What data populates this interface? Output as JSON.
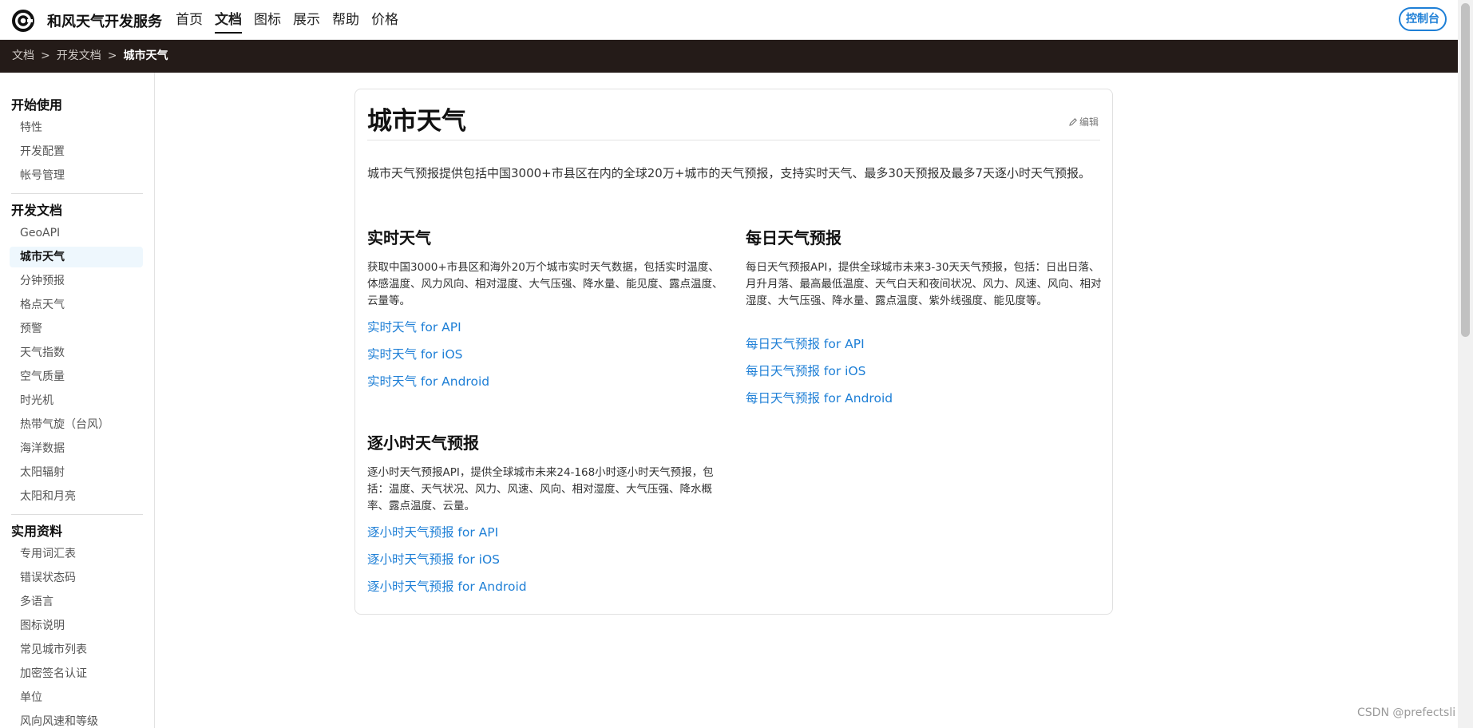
{
  "header": {
    "brand": "和风天气开发服务",
    "nav": [
      "首页",
      "文档",
      "图标",
      "展示",
      "帮助",
      "价格"
    ],
    "active_nav": "文档",
    "console_label": "控制台"
  },
  "breadcrumb": {
    "items": [
      "文档",
      "开发文档",
      "城市天气"
    ],
    "separator": ">"
  },
  "sidebar": {
    "sections": [
      {
        "title": "开始使用",
        "items": [
          "特性",
          "开发配置",
          "帐号管理"
        ]
      },
      {
        "title": "开发文档",
        "items": [
          "GeoAPI",
          "城市天气",
          "分钟预报",
          "格点天气",
          "预警",
          "天气指数",
          "空气质量",
          "时光机",
          "热带气旋（台风）",
          "海洋数据",
          "太阳辐射",
          "太阳和月亮"
        ]
      },
      {
        "title": "实用资料",
        "items": [
          "专用词汇表",
          "错误状态码",
          "多语言",
          "图标说明",
          "常见城市列表",
          "加密签名认证",
          "单位",
          "风向风速和等级"
        ]
      }
    ],
    "active_item": "城市天气"
  },
  "main": {
    "title": "城市天气",
    "edit_label": "编辑",
    "intro": "城市天气预报提供包括中国3000+市县区在内的全球20万+城市的天气预报，支持实时天气、最多30天预报及最多7天逐小时天气预报。",
    "cards": [
      {
        "title": "实时天气",
        "desc": "获取中国3000+市县区和海外20万个城市实时天气数据，包括实时温度、体感温度、风力风向、相对湿度、大气压强、降水量、能见度、露点温度、云量等。",
        "links": [
          "实时天气 for API",
          "实时天气 for iOS",
          "实时天气 for Android"
        ]
      },
      {
        "title": "每日天气预报",
        "desc": "每日天气预报API，提供全球城市未来3-30天天气预报，包括：日出日落、月升月落、最高最低温度、天气白天和夜间状况、风力、风速、风向、相对湿度、大气压强、降水量、露点温度、紫外线强度、能见度等。",
        "links": [
          "每日天气预报 for API",
          "每日天气预报 for iOS",
          "每日天气预报 for Android"
        ]
      },
      {
        "title": "逐小时天气预报",
        "desc": "逐小时天气预报API，提供全球城市未来24-168小时逐小时天气预报，包括：温度、天气状况、风力、风速、风向、相对湿度、大气压强、降水概率、露点温度、云量。",
        "links": [
          "逐小时天气预报 for API",
          "逐小时天气预报 for iOS",
          "逐小时天气预报 for Android"
        ]
      }
    ]
  },
  "watermark": "CSDN @prefectsli",
  "colors": {
    "link": "#1e7fd6",
    "breadcrumb_bg": "#241b18",
    "active_sidebar_bg": "#eef7fd"
  },
  "icons": [
    "logo-icon",
    "pencil-icon"
  ]
}
